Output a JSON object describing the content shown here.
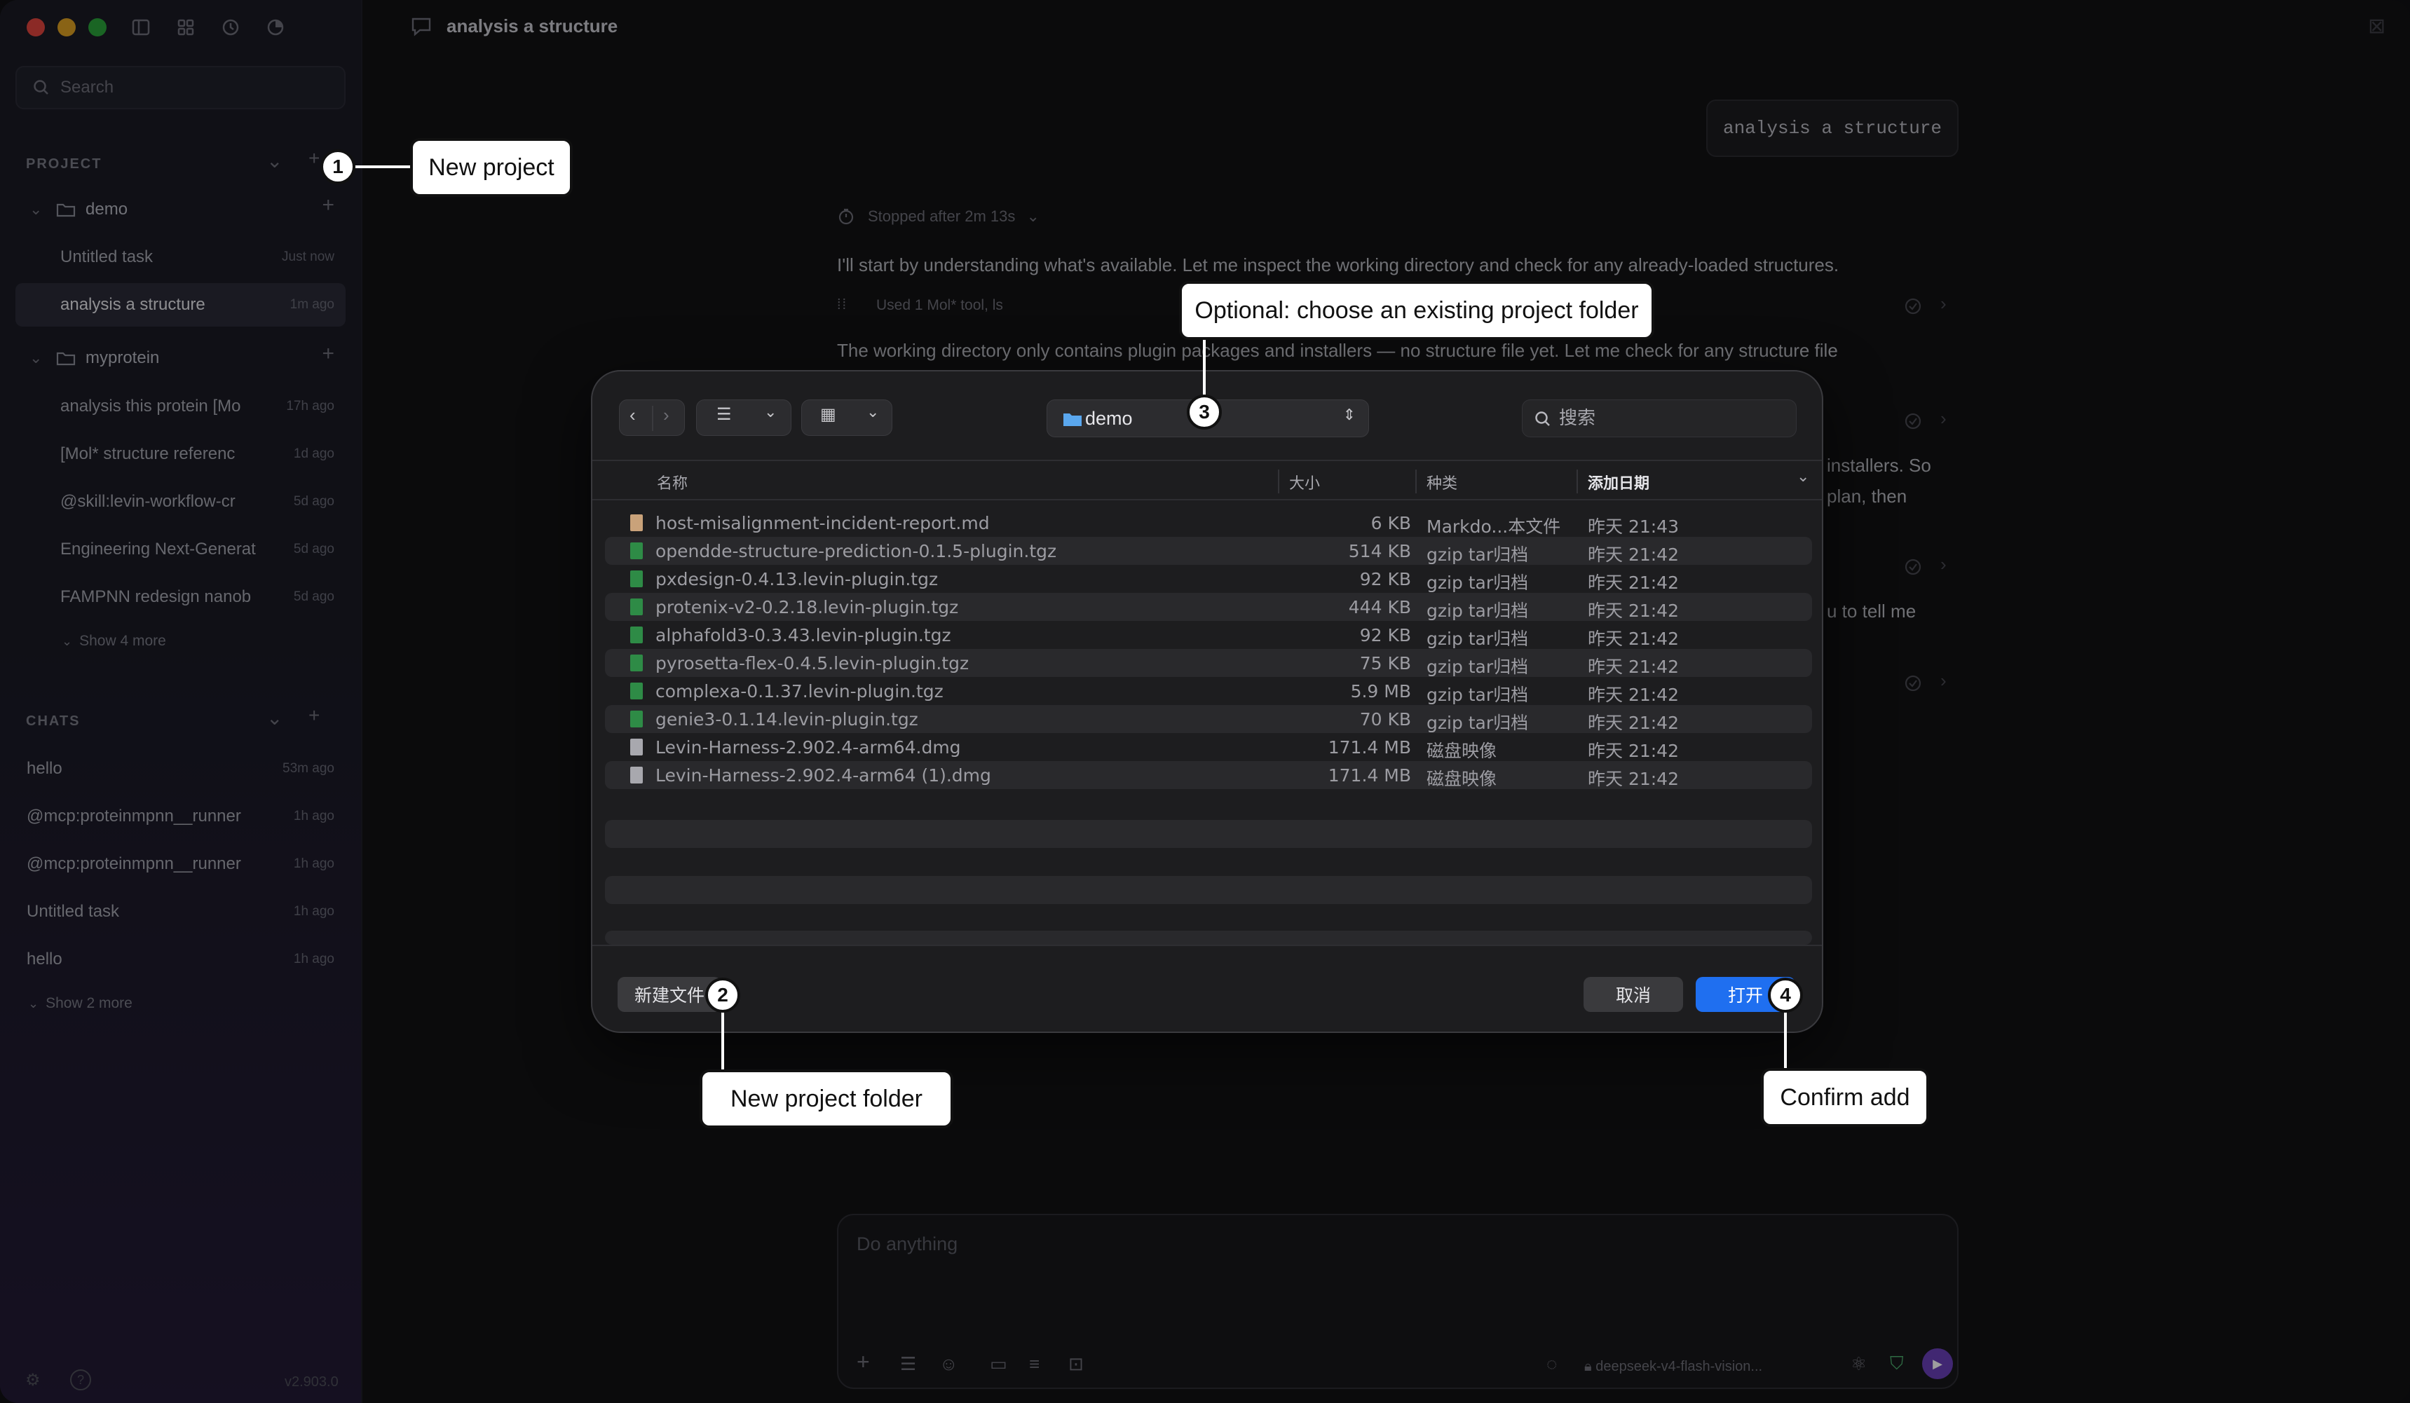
{
  "sidebar": {
    "search_placeholder": "Search",
    "project_header": "PROJECT",
    "chats_header": "CHATS",
    "projects": [
      {
        "name": "demo",
        "tasks": [
          {
            "label": "Untitled task",
            "time": "Just now"
          },
          {
            "label": "analysis a structure",
            "time": "1m ago"
          }
        ]
      },
      {
        "name": "myprotein",
        "tasks": [
          {
            "label": "analysis this protein [Mo",
            "time": "17h ago"
          },
          {
            "label": "[Mol* structure referenc",
            "time": "1d ago"
          },
          {
            "label": "@skill:levin-workflow-cr",
            "time": "5d ago"
          },
          {
            "label": "Engineering Next-Generat",
            "time": "5d ago"
          },
          {
            "label": "FAMPNN redesign nanob",
            "time": "5d ago"
          }
        ],
        "show_more": "Show 4 more"
      }
    ],
    "chats": [
      {
        "label": "hello",
        "time": "53m ago"
      },
      {
        "label": "@mcp:proteinmpnn__runner",
        "time": "1h ago"
      },
      {
        "label": "@mcp:proteinmpnn__runner",
        "time": "1h ago"
      },
      {
        "label": "Untitled task",
        "time": "1h ago"
      },
      {
        "label": "hello",
        "time": "1h ago"
      }
    ],
    "chats_show_more": "Show 2 more",
    "version": "v2.903.0"
  },
  "main": {
    "title": "analysis a structure",
    "user_message": "analysis a structure",
    "stopped": "Stopped after 2m 13s",
    "line1": "I'll start by understanding what's available. Let me inspect the working directory and check for any already-loaded structures.",
    "tool_used": "Used 1 Mol* tool, ls",
    "line2": "The working directory only contains plugin packages and installers — no structure file yet. Let me check for any structure file",
    "frag1": "installers. So",
    "frag2": "plan, then",
    "frag3": "u to tell me",
    "composer_placeholder": "Do anything",
    "model": "deepseek-v4-flash-vision..."
  },
  "dialog": {
    "location": "demo",
    "search_placeholder": "搜索",
    "columns": {
      "name": "名称",
      "size": "大小",
      "kind": "种类",
      "date": "添加日期"
    },
    "files": [
      {
        "name": "host-misalignment-incident-report.md",
        "size": "6 KB",
        "kind": "Markdo...本文件",
        "date": "昨天 21:43",
        "icon": "doc"
      },
      {
        "name": "opendde-structure-prediction-0.1.5-plugin.tgz",
        "size": "514 KB",
        "kind": "gzip tar归档",
        "date": "昨天 21:42",
        "icon": "archive"
      },
      {
        "name": "pxdesign-0.4.13.levin-plugin.tgz",
        "size": "92 KB",
        "kind": "gzip tar归档",
        "date": "昨天 21:42",
        "icon": "archive"
      },
      {
        "name": "protenix-v2-0.2.18.levin-plugin.tgz",
        "size": "444 KB",
        "kind": "gzip tar归档",
        "date": "昨天 21:42",
        "icon": "archive"
      },
      {
        "name": "alphafold3-0.3.43.levin-plugin.tgz",
        "size": "92 KB",
        "kind": "gzip tar归档",
        "date": "昨天 21:42",
        "icon": "archive"
      },
      {
        "name": "pyrosetta-flex-0.4.5.levin-plugin.tgz",
        "size": "75 KB",
        "kind": "gzip tar归档",
        "date": "昨天 21:42",
        "icon": "archive"
      },
      {
        "name": "complexa-0.1.37.levin-plugin.tgz",
        "size": "5.9 MB",
        "kind": "gzip tar归档",
        "date": "昨天 21:42",
        "icon": "archive"
      },
      {
        "name": "genie3-0.1.14.levin-plugin.tgz",
        "size": "70 KB",
        "kind": "gzip tar归档",
        "date": "昨天 21:42",
        "icon": "archive"
      },
      {
        "name": "Levin-Harness-2.902.4-arm64.dmg",
        "size": "171.4 MB",
        "kind": "磁盘映像",
        "date": "昨天 21:42",
        "icon": "disk"
      },
      {
        "name": "Levin-Harness-2.902.4-arm64 (1).dmg",
        "size": "171.4 MB",
        "kind": "磁盘映像",
        "date": "昨天 21:42",
        "icon": "disk"
      }
    ],
    "new_folder": "新建文件",
    "cancel": "取消",
    "open": "打开"
  },
  "annotations": {
    "b1": "1",
    "b2": "2",
    "b3": "3",
    "b4": "4",
    "c1": "New project",
    "c2": "New project folder",
    "c3": "Optional: choose an existing project folder",
    "c4": "Confirm add"
  },
  "colors": {
    "accent_blue": "#1f6ff0",
    "archive_green": "#2e8b46",
    "close": "#e0443e",
    "minimize": "#dea123",
    "zoom": "#2aa33a"
  }
}
